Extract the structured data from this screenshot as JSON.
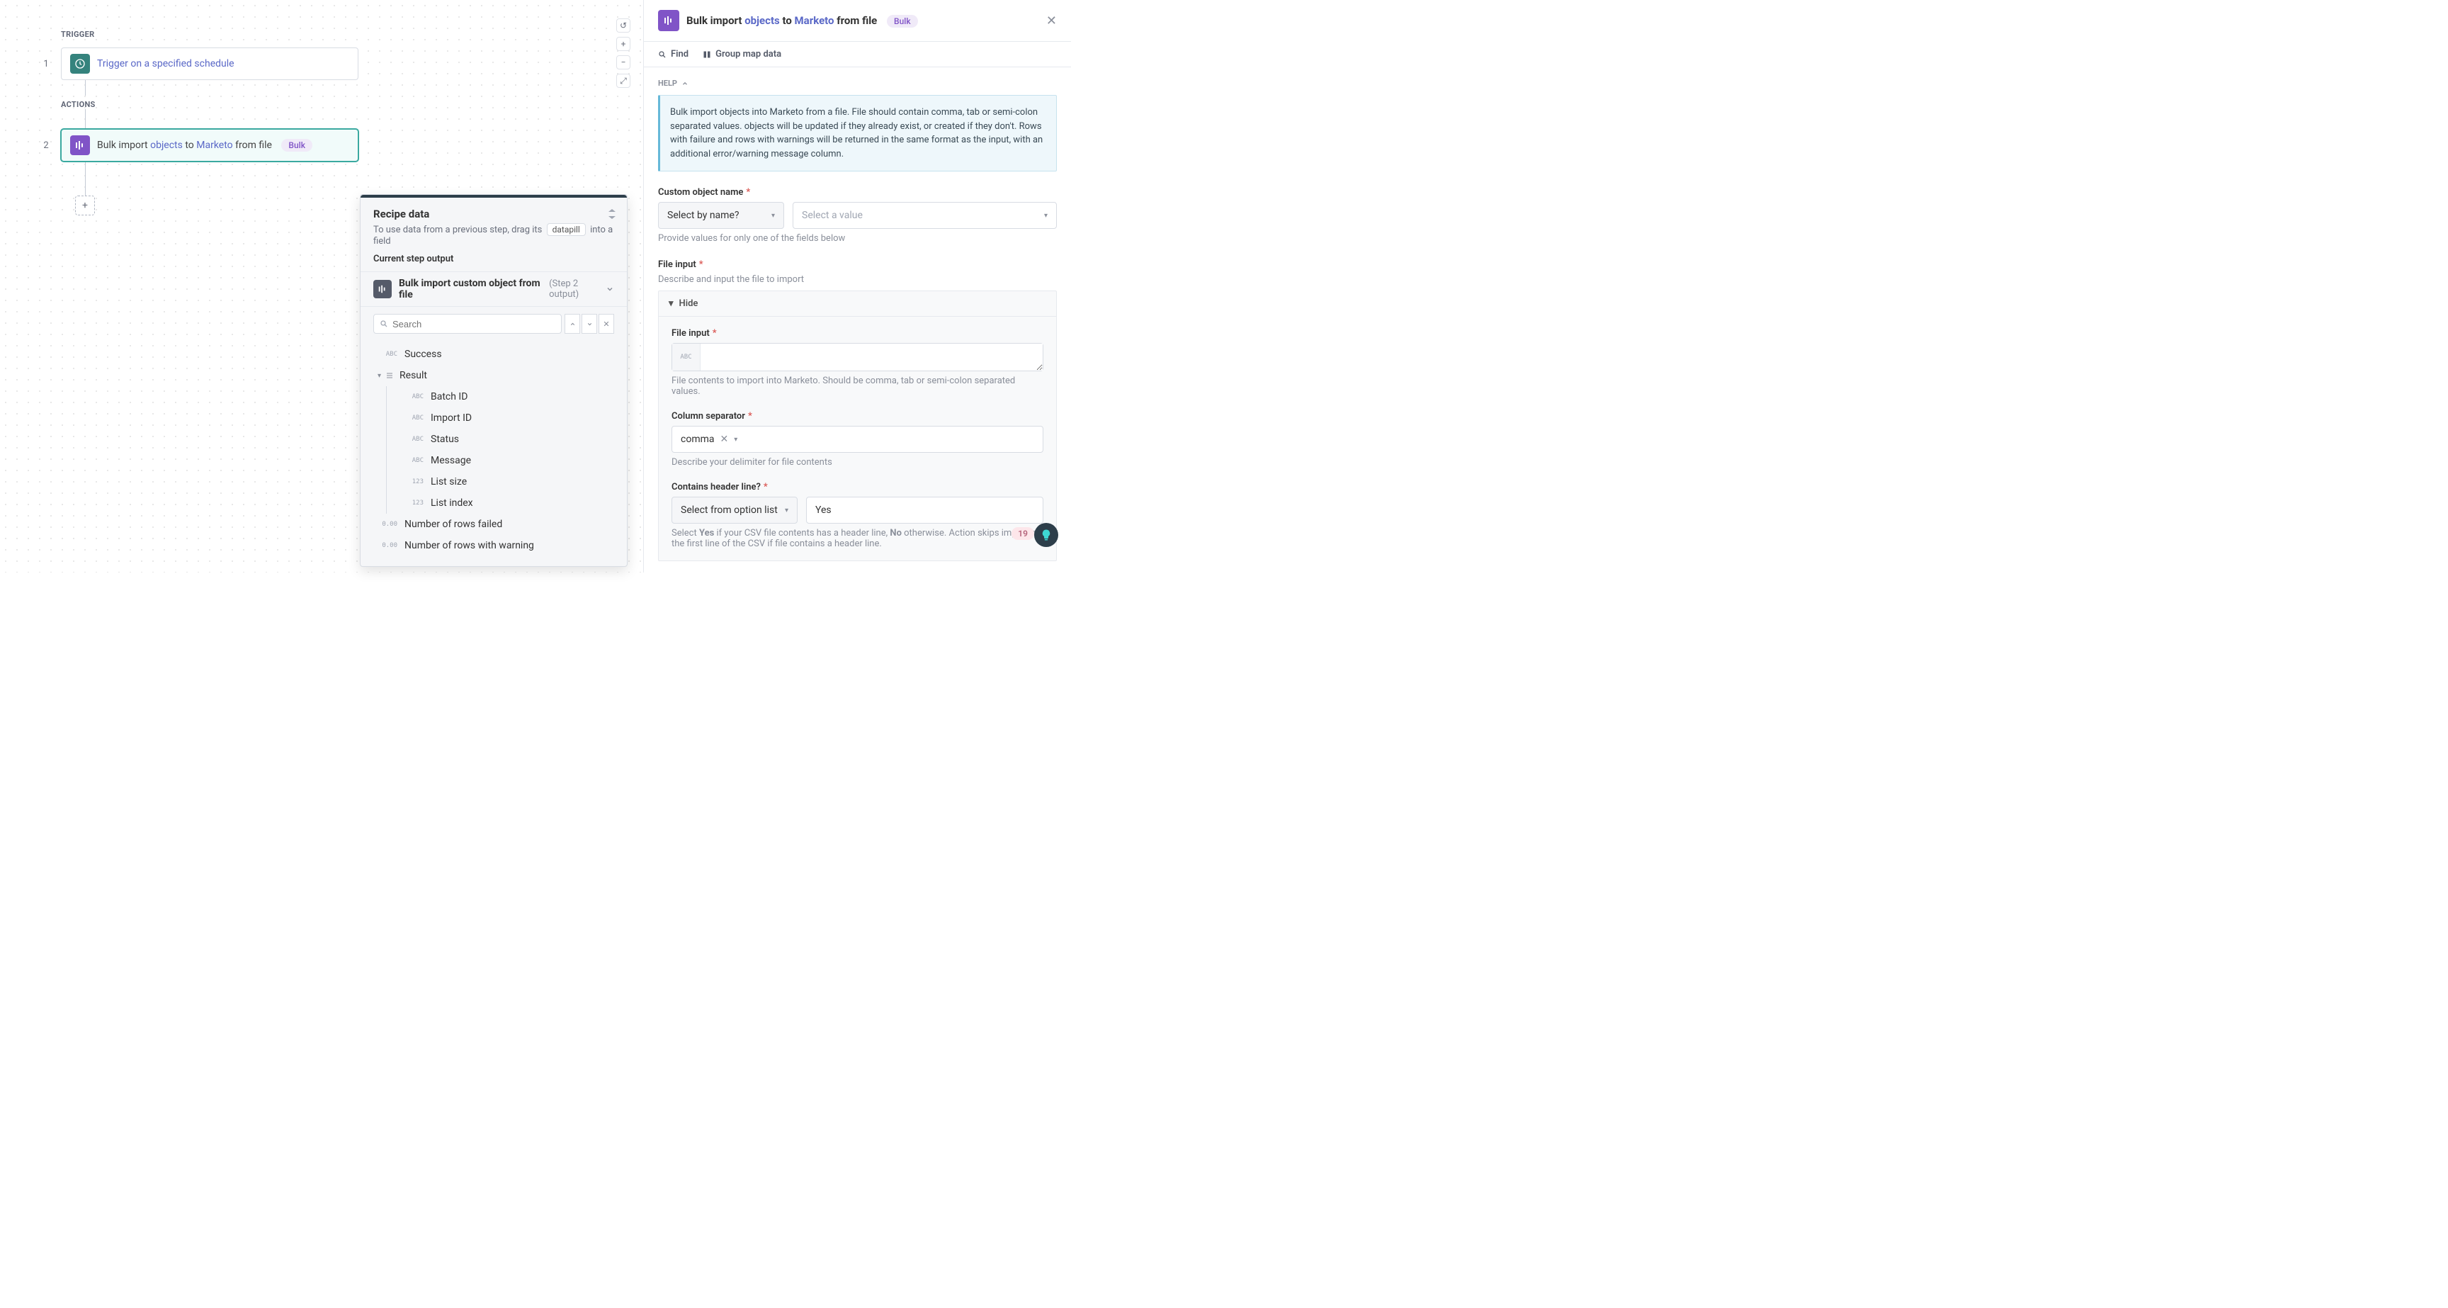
{
  "canvas": {
    "trigger_label": "TRIGGER",
    "actions_label": "ACTIONS",
    "step1_num": "1",
    "step2_num": "2",
    "step1_text": "Trigger on a specified schedule",
    "step2_prefix": "Bulk import ",
    "step2_objects": "objects",
    "step2_to": " to ",
    "step2_marketo": "Marketo",
    "step2_suffix": " from file",
    "badge_bulk": "Bulk",
    "add_plus": "+"
  },
  "controls": {
    "undo": "↺",
    "plus": "+",
    "minus": "−",
    "fit": "⤢"
  },
  "recipe": {
    "title": "Recipe data",
    "sub_pre": "To use data from a previous step, drag its",
    "datapill": "datapill",
    "sub_post": "into a field",
    "section": "Current step output",
    "output_name": "Bulk import custom object from file",
    "output_meta": "(Step 2 output)",
    "search_placeholder": "Search",
    "tree": {
      "success": "Success",
      "result": "Result",
      "batch_id": "Batch ID",
      "import_id": "Import ID",
      "status": "Status",
      "message": "Message",
      "list_size": "List size",
      "list_index": "List index",
      "rows_failed": "Number of rows failed",
      "rows_warning": "Number of rows with warning"
    },
    "type_abc": "ABC",
    "type_123": "123",
    "type_dec": "0.00"
  },
  "panel": {
    "title_prefix": "Bulk import ",
    "title_objects": "objects",
    "title_to": " to ",
    "title_marketo": "Marketo",
    "title_suffix": " from file",
    "find": "Find",
    "group": "Group map data",
    "help_label": "HELP",
    "help_text": "Bulk import objects into Marketo from a file. File should contain comma, tab or semi-colon separated values. objects will be updated if they already exist, or created if they don't. Rows with failure and rows with warnings will be returned in the same format as the input, with an additional error/warning message column.",
    "obj_name_label": "Custom object name",
    "select_by_name": "Select by name?",
    "select_value_ph": "Select a value",
    "obj_name_hint": "Provide values for only one of the fields below",
    "file_input_label": "File input",
    "file_input_hint": "Describe and input the file to import",
    "hide": "Hide",
    "inner_file_label": "File input",
    "inner_file_hint": "File contents to import into Marketo. Should be comma, tab or semi-colon separated values.",
    "col_sep_label": "Column separator",
    "col_sep_value": "comma",
    "col_sep_hint": "Describe your delimiter for file contents",
    "header_label": "Contains header line?",
    "header_select": "Select from option list",
    "header_value": "Yes",
    "header_hint_pre": "Select ",
    "header_hint_yes": "Yes",
    "header_hint_mid": " if your CSV file contents has a header line, ",
    "header_hint_no": "No",
    "header_hint_post": " otherwise. Action skips importing the first line of the CSV if file contains a header line.",
    "badge_count": "19",
    "req": "*",
    "abc": "ABC"
  }
}
